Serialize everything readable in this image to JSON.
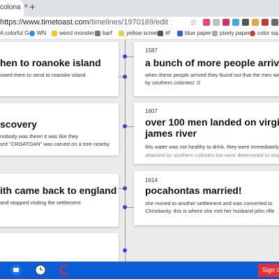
{
  "browser": {
    "tab_title": "colonali",
    "tab_close": "×",
    "new_tab": "+",
    "url_host": "https://www.timetoast.com",
    "url_path": "/timelines/1970169/edit",
    "star": "☆",
    "bookmarks": [
      "A colorful G",
      "WN",
      "weird monster",
      "barf",
      "yellow screen",
      "#f",
      "blue paper",
      "pixely paper",
      "color squa"
    ]
  },
  "timeline": {
    "left_cards": [
      {
        "title": "hen to roanoke island",
        "desc": "owed them to send to roanoke island"
      },
      {
        "title": "scovery",
        "desc_lines": [
          "nobody was there! it was like they",
          "ord \"CROATOAN\" was carved on a tree nearby"
        ]
      },
      {
        "title": "ith came back to england",
        "desc": "and stopped visiting the settlement"
      }
    ],
    "right_cards": [
      {
        "date": "1587",
        "title": "a bunch of more people arrived",
        "desc_lines": [
          "when these people arrived they found out that the men we",
          "by southern colonies! :0"
        ]
      },
      {
        "date": "1607",
        "title_lines": [
          "over 100 men landed on virginia",
          "james river"
        ],
        "desc_lines": [
          "this water was not healthy to drink. they were immediately",
          "attacked by southern colonies but were determined to stay"
        ]
      },
      {
        "date": "1614",
        "title": "pocahontas married!",
        "desc_lines": [
          "she moved to another settlement and was converted to",
          "Christianity. this is where she met her husband john rifle"
        ]
      }
    ]
  },
  "taskbar": {
    "sign_out": "Sign ou"
  },
  "colors": {
    "accent_dot": "#4a3bd6",
    "taskbar": "#0a5cd7",
    "signout": "#e0303a"
  }
}
